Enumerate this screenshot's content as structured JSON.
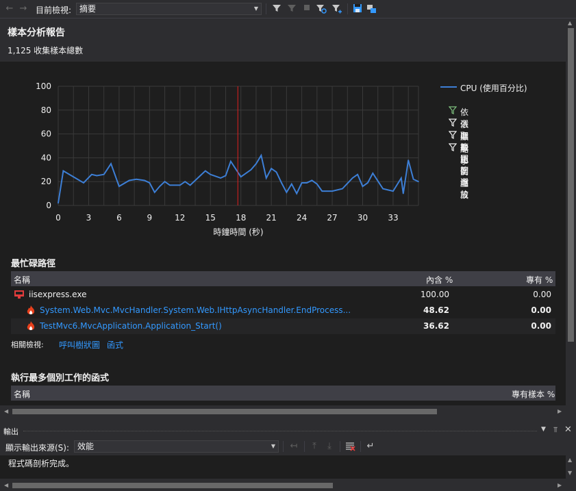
{
  "toolbar": {
    "back_icon": "arrow-left-icon",
    "forward_icon": "arrow-right-icon",
    "view_label": "目前檢視:",
    "view_value": "摘要",
    "icons": [
      "filter-icon",
      "filter-clear-icon",
      "stop-icon",
      "filter-zoom-icon",
      "filter-reset-icon",
      "save-icon",
      "compare-icon"
    ]
  },
  "report": {
    "title": "樣本分析報告",
    "sample_count": "1,125 收集樣本總數"
  },
  "chart_data": {
    "type": "line",
    "xlabel": "時鐘時間 (秒)",
    "ylabel": "",
    "ylim": [
      0,
      100
    ],
    "xlim": [
      0,
      35.5
    ],
    "yticks": [
      "100",
      "80",
      "60",
      "40",
      "20",
      "0"
    ],
    "xticks": [
      "0",
      "3",
      "6",
      "9",
      "12",
      "15",
      "18",
      "21",
      "24",
      "27",
      "30",
      "33"
    ],
    "grid": true,
    "series": [
      {
        "name": "CPU (使用百分比)",
        "color": "#3d7fd6",
        "x": [
          0,
          0.5,
          1.5,
          2.5,
          3.3,
          3.8,
          4.5,
          5.2,
          6,
          7,
          7.7,
          8.5,
          9,
          9.5,
          10,
          10.5,
          11,
          12,
          12.5,
          13,
          14,
          14.5,
          15,
          16,
          16.5,
          17,
          18,
          19,
          19.5,
          20,
          20.5,
          21,
          21.5,
          22,
          22.5,
          23,
          23.5,
          24,
          24.5,
          25,
          25.5,
          26,
          27,
          28,
          29,
          29.5,
          30,
          30.5,
          31,
          32,
          32.5,
          33,
          33.8,
          34,
          34.5,
          35,
          35.5
        ],
        "values": [
          2,
          29,
          24,
          19,
          26,
          25,
          26,
          35,
          16,
          21,
          22,
          21,
          19,
          11,
          16,
          20,
          17,
          17,
          20,
          17,
          25,
          29,
          26,
          23,
          25,
          37,
          24,
          30,
          35,
          42,
          23,
          31,
          28,
          19,
          11,
          18,
          10,
          19,
          19,
          21,
          18,
          12,
          12,
          14,
          23,
          26,
          16,
          19,
          27,
          14,
          13,
          12,
          23,
          10,
          38,
          22,
          20
        ]
      }
    ],
    "marker_x": 17.7,
    "legend_position": "right",
    "legend_actions": [
      "依選取範圍篩選",
      "依選取範圍縮放",
      "顯示比例重設",
      "縮小"
    ]
  },
  "hot_path": {
    "title": "最忙碌路徑",
    "col_name": "名稱",
    "col_inclusive": "內含 %",
    "col_exclusive": "專有 %",
    "rows": [
      {
        "name": "iisexpress.exe",
        "inclusive": "100.00",
        "exclusive": "0.00",
        "icon": "process-icon",
        "link": false
      },
      {
        "name": "System.Web.Mvc.MvcHandler.System.Web.IHttpAsyncHandler.EndProcess...",
        "inclusive": "48.62",
        "exclusive": "0.00",
        "icon": "hot-flame-icon",
        "link": true
      },
      {
        "name": "TestMvc6.MvcApplication.Application_Start()",
        "inclusive": "36.62",
        "exclusive": "0.00",
        "icon": "hot-flame-icon",
        "link": true
      }
    ],
    "related_label": "相關檢視:",
    "related_links": [
      "呼叫樹狀圖",
      "函式"
    ]
  },
  "functions": {
    "title": "執行最多個別工作的函式",
    "col_name": "名稱",
    "col_exclusive": "專有樣本 %"
  },
  "output": {
    "title": "輸出",
    "source_label": "顯示輸出來源(S):",
    "source_value": "效能",
    "text": "程式碼剖析完成。"
  }
}
